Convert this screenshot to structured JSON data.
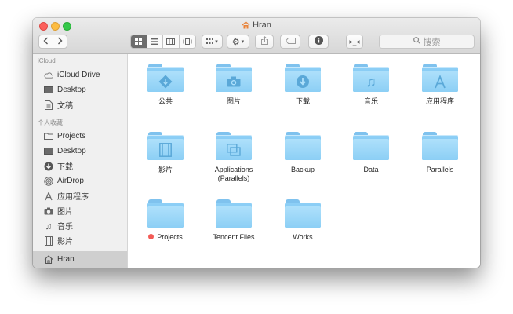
{
  "window": {
    "title": "Hran"
  },
  "toolbar": {
    "search_placeholder": "搜索"
  },
  "sidebar": {
    "sections": [
      {
        "header": "iCloud",
        "items": [
          {
            "label": "iCloud Drive",
            "icon": "cloud-icon"
          },
          {
            "label": "Desktop",
            "icon": "desktop-icon"
          },
          {
            "label": "文稿",
            "icon": "document-icon"
          }
        ]
      },
      {
        "header": "个人收藏",
        "items": [
          {
            "label": "Projects",
            "icon": "folder-icon"
          },
          {
            "label": "Desktop",
            "icon": "desktop-icon"
          },
          {
            "label": "下载",
            "icon": "download-icon"
          },
          {
            "label": "AirDrop",
            "icon": "airdrop-icon"
          },
          {
            "label": "应用程序",
            "icon": "applications-icon"
          },
          {
            "label": "图片",
            "icon": "camera-icon"
          },
          {
            "label": "音乐",
            "icon": "music-icon"
          },
          {
            "label": "影片",
            "icon": "film-icon"
          },
          {
            "label": "Hran",
            "icon": "home-icon",
            "selected": true
          }
        ]
      }
    ]
  },
  "files": [
    {
      "name": "公共",
      "glyph": "public-icon"
    },
    {
      "name": "图片",
      "glyph": "camera-icon"
    },
    {
      "name": "下载",
      "glyph": "download-icon"
    },
    {
      "name": "音乐",
      "glyph": "music-icon"
    },
    {
      "name": "应用程序",
      "glyph": "applications-icon"
    },
    {
      "name": "影片",
      "glyph": "film-icon"
    },
    {
      "name": "Applications (Parallels)",
      "glyph": "parallels-apps-icon"
    },
    {
      "name": "Backup",
      "glyph": ""
    },
    {
      "name": "Data",
      "glyph": ""
    },
    {
      "name": "Parallels",
      "glyph": ""
    },
    {
      "name": "Projects",
      "glyph": "",
      "tag_color": "#f35b56"
    },
    {
      "name": "Tencent Files",
      "glyph": ""
    },
    {
      "name": "Works",
      "glyph": ""
    }
  ]
}
